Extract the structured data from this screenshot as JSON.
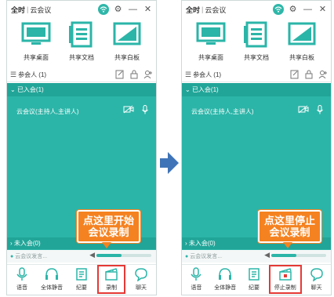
{
  "left_panel": {
    "title_brand": "全时",
    "title_app": "云会议",
    "share_items": [
      "共享桌面",
      "共享文档",
      "共享白板"
    ],
    "participants_label": "参会人 (1)",
    "joined_label": "已入会(1)",
    "member_name": "云会议(主持人,主讲人)",
    "not_joined_label": "未入会(0)",
    "voice_label": "云会议发言...",
    "volume": 0.45,
    "toolbar": [
      "语音",
      "全体静音",
      "纪要",
      "录制",
      "聊天"
    ],
    "callout": [
      "点这里开始",
      "会议录制"
    ]
  },
  "right_panel": {
    "title_brand": "全时",
    "title_app": "云会议",
    "share_items": [
      "共享桌面",
      "共享文档",
      "共享白板"
    ],
    "participants_label": "参会人 (1)",
    "joined_label": "已入会(1)",
    "member_name": "云会议(主持人,主讲人)",
    "not_joined_label": "未入会(0)",
    "voice_label": "云会议发言...",
    "volume": 0.45,
    "toolbar": [
      "语音",
      "全体静音",
      "纪要",
      "停止录制",
      "聊天"
    ],
    "callout": [
      "点这里停止",
      "会议录制"
    ]
  },
  "colors": {
    "teal": "#2bb5a8",
    "teal_dark": "#21a598",
    "callout": "#f58220",
    "highlight": "#e53935",
    "arrow": "#3f74b8"
  }
}
